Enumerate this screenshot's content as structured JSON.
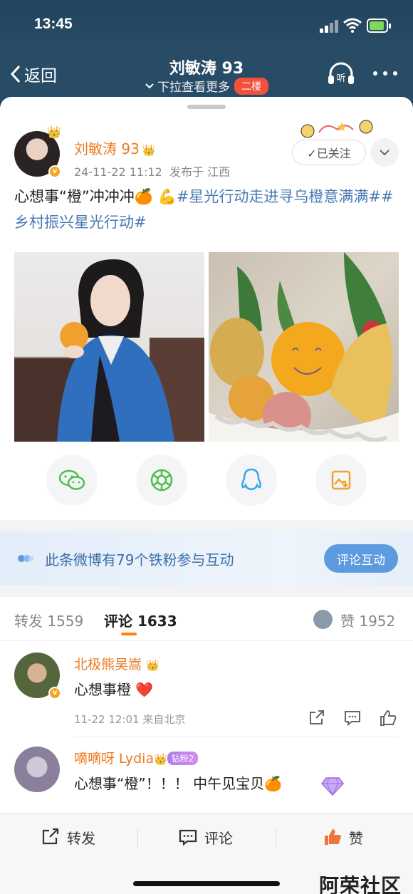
{
  "status_bar": {
    "time": "13:45"
  },
  "nav": {
    "back_label": "返回",
    "title": "刘敏涛 93",
    "subtitle": "下拉查看更多",
    "floor_badge": "二楼",
    "listen_label": "听"
  },
  "post": {
    "author": "刘敏涛 93",
    "date": "24-11-22 11:12",
    "location": "发布于 江西",
    "follow_label": "✓已关注",
    "text_plain": "心想事“橙”冲冲冲🍊 💪",
    "hashtag1": "#星光行动走进寻乌橙意满满#",
    "hashtag2": "#乡村振兴星光行动#"
  },
  "share_icons": [
    "wechat-icon",
    "moments-icon",
    "qq-icon",
    "save-image-icon"
  ],
  "fan_banner": {
    "text": "此条微博有79个铁粉参与互动",
    "button": "评论互动"
  },
  "tabs": {
    "repost": "转发 1559",
    "comments": "评论 1633",
    "likes": "赞 1952"
  },
  "comments": [
    {
      "name": "北极熊吴嵩",
      "text": "心想事橙 ❤️",
      "meta": "11-22 12:01 来自北京"
    },
    {
      "name": "嘀嘀呀 Lydia",
      "badge": "钻粉2",
      "text": "心想事“橙”！！！ 中午见宝贝🍊"
    }
  ],
  "bottom_bar": {
    "repost": "转发",
    "comment": "评论",
    "like": "赞"
  },
  "watermark": "阿荣社区",
  "colors": {
    "accent_orange": "#ff8200",
    "name_orange": "#ec7a1f",
    "link_blue": "#4a7ab5",
    "header_bg": "#294c66"
  }
}
